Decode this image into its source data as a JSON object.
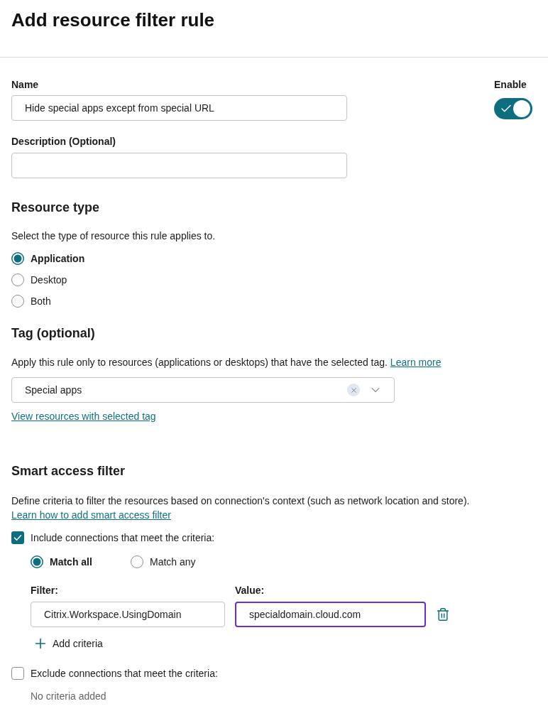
{
  "title": "Add resource filter rule",
  "name_field": {
    "label": "Name",
    "value": "Hide special apps except from special URL"
  },
  "enable_toggle": {
    "label": "Enable",
    "on": true
  },
  "description_field": {
    "label": "Description (Optional)"
  },
  "resource_type": {
    "heading": "Resource type",
    "instruction": "Select the type of resource this rule applies to.",
    "options": [
      {
        "label": "Application",
        "selected": true
      },
      {
        "label": "Desktop",
        "selected": false
      },
      {
        "label": "Both",
        "selected": false
      }
    ]
  },
  "tag": {
    "heading": "Tag (optional)",
    "text": "Apply this rule only to resources (applications or desktops) that have the selected tag.",
    "link": "Learn more",
    "select": {
      "value": "Special apps"
    },
    "view_link": "View resources with selected tag"
  },
  "smart_access_filter": {
    "heading": "Smart access filter",
    "text": "Define criteria to filter the resources based on connection's context (such as network location and store).",
    "link": "Learn how to add smart access filter",
    "include": {
      "label": "Include connections that meet the criteria:",
      "checked": true,
      "match_options": [
        {
          "label": "Match all",
          "selected": true
        },
        {
          "label": "Match any",
          "selected": false
        }
      ],
      "filter_label": "Filter:",
      "value_label": "Value:",
      "criteria": [
        {
          "filter": "Citrix.Workspace.UsingDomain",
          "value": "specialdomain.cloud.com",
          "focused": true
        }
      ],
      "add_label": "Add criteria"
    },
    "exclude": {
      "label": "Exclude connections that meet the criteria:",
      "checked": false,
      "empty_text": "No criteria added"
    }
  }
}
